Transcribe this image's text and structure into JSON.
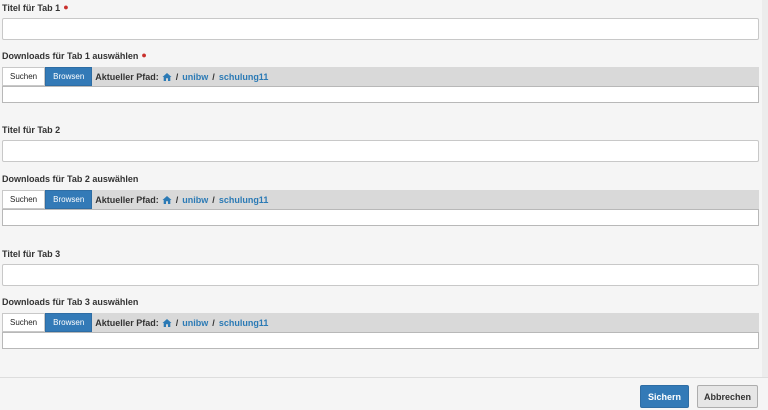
{
  "tabs": [
    {
      "title_label": "Titel für Tab 1",
      "title_required": true,
      "title_value": "",
      "downloads_label": "Downloads für Tab 1 auswählen",
      "downloads_required": true
    },
    {
      "title_label": "Titel für Tab 2",
      "title_required": false,
      "title_value": "",
      "downloads_label": "Downloads für Tab 2 auswählen",
      "downloads_required": false
    },
    {
      "title_label": "Titel für Tab 3",
      "title_required": false,
      "title_value": "",
      "downloads_label": "Downloads für Tab 3 auswählen",
      "downloads_required": false
    }
  ],
  "browser": {
    "search_label": "Suchen",
    "browse_label": "Browsen",
    "path_label": "Aktueller Pfad:",
    "path_icon": "home-icon",
    "path_segments": [
      "unibw",
      "schulung11"
    ]
  },
  "footer": {
    "save_label": "Sichern",
    "cancel_label": "Abbrechen"
  },
  "colors": {
    "primary": "#337ab7",
    "link": "#2b7ab5",
    "required": "#c9302c",
    "bar": "#d9d9d9"
  }
}
